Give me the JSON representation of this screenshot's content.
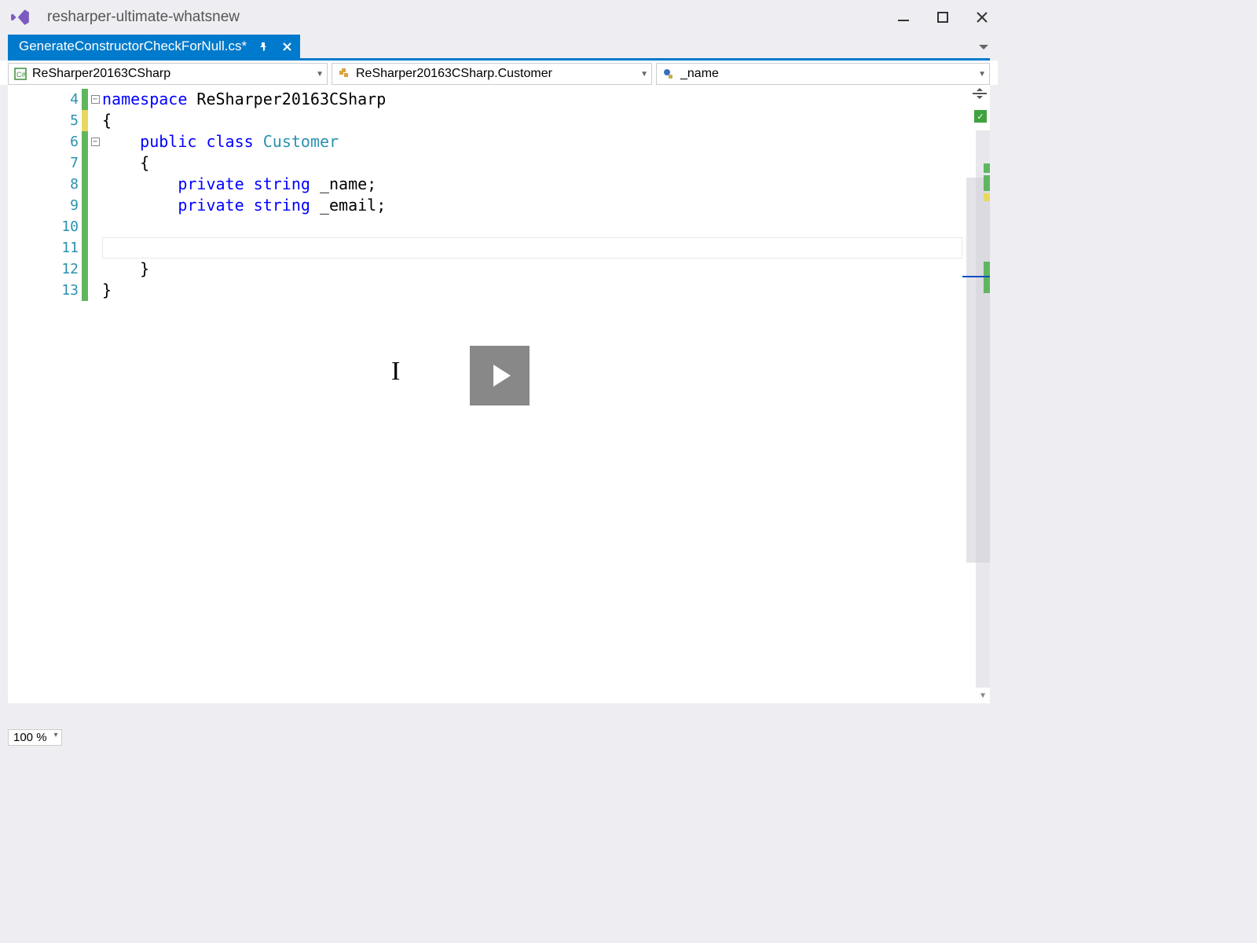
{
  "window": {
    "title": "resharper-ultimate-whatsnew"
  },
  "tab": {
    "filename": "GenerateConstructorCheckForNull.cs*"
  },
  "nav": {
    "scope1": "ReSharper20163CSharp",
    "scope2": "ReSharper20163CSharp.Customer",
    "scope3": "_name"
  },
  "code": {
    "lines": [
      {
        "num": "4",
        "fold": "box",
        "change": "green",
        "tokens": [
          [
            "kw",
            "namespace"
          ],
          [
            "plain",
            " ReSharper20163CSharp"
          ]
        ]
      },
      {
        "num": "5",
        "fold": "line",
        "change": "yellow",
        "tokens": [
          [
            "plain",
            "{"
          ]
        ]
      },
      {
        "num": "6",
        "fold": "box",
        "change": "green",
        "tokens": [
          [
            "plain",
            "    "
          ],
          [
            "kw",
            "public"
          ],
          [
            "plain",
            " "
          ],
          [
            "kw",
            "class"
          ],
          [
            "plain",
            " "
          ],
          [
            "type",
            "Customer"
          ]
        ]
      },
      {
        "num": "7",
        "fold": "line",
        "change": "green",
        "tokens": [
          [
            "plain",
            "    {"
          ]
        ]
      },
      {
        "num": "8",
        "fold": "line",
        "change": "green",
        "tokens": [
          [
            "plain",
            "        "
          ],
          [
            "kw",
            "private"
          ],
          [
            "plain",
            " "
          ],
          [
            "kw",
            "string"
          ],
          [
            "plain",
            " _name;"
          ]
        ]
      },
      {
        "num": "9",
        "fold": "line",
        "change": "green",
        "tokens": [
          [
            "plain",
            "        "
          ],
          [
            "kw",
            "private"
          ],
          [
            "plain",
            " "
          ],
          [
            "kw",
            "string"
          ],
          [
            "plain",
            " _email;"
          ]
        ]
      },
      {
        "num": "10",
        "fold": "line",
        "change": "green",
        "tokens": []
      },
      {
        "num": "11",
        "fold": "line",
        "change": "green",
        "tokens": [],
        "current": true
      },
      {
        "num": "12",
        "fold": "line",
        "change": "green",
        "tokens": [
          [
            "plain",
            "    }"
          ]
        ]
      },
      {
        "num": "13",
        "fold": "end",
        "change": "green",
        "tokens": [
          [
            "plain",
            "}"
          ]
        ]
      }
    ]
  },
  "status": {
    "zoom": "100 %"
  }
}
